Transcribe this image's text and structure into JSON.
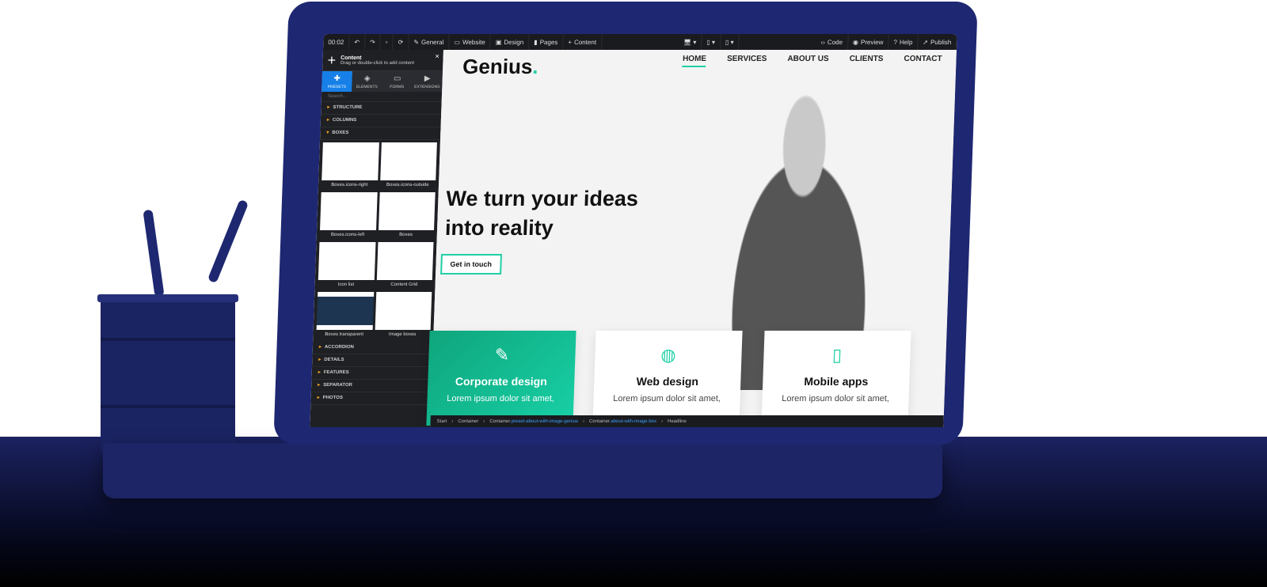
{
  "toolbar": {
    "time": "00:02",
    "general": "General",
    "website": "Website",
    "design": "Design",
    "pages": "Pages",
    "content": "Content",
    "code": "Code",
    "preview": "Preview",
    "help": "Help",
    "publish": "Publish"
  },
  "panel": {
    "title": "Content",
    "subtitle": "Drag or double-click to add content",
    "close": "×",
    "tabs": [
      {
        "label": "PRESETS",
        "icon": "puzzle-icon"
      },
      {
        "label": "ELEMENTS",
        "icon": "cube-icon"
      },
      {
        "label": "FORMS",
        "icon": "form-icon"
      },
      {
        "label": "EXTENSIONS",
        "icon": "play-icon"
      }
    ],
    "search_placeholder": "Search...",
    "categories_top": [
      "STRUCTURE",
      "COLUMNS",
      "BOXES"
    ],
    "presets": [
      "Boxes.icons-right",
      "Boxes.icons-outside",
      "Boxes.icons-left",
      "Boxes",
      "Icon list",
      "Content Grid",
      "Boxes transparent",
      "Image boxes"
    ],
    "categories_bottom": [
      "ACCORDION",
      "DETAILS",
      "FEATURES",
      "SEPARATOR",
      "PHOTOS"
    ]
  },
  "site": {
    "logo": "Genius",
    "logo_dot": ".",
    "nav": [
      "HOME",
      "SERVICES",
      "ABOUT US",
      "CLIENTS",
      "CONTACT"
    ],
    "hero_line1": "We turn your ideas",
    "hero_line2": "into reality",
    "cta": "Get in touch",
    "boxes": [
      {
        "title": "Corporate design",
        "text": "Lorem ipsum dolor sit amet,",
        "icon": "pencil-icon"
      },
      {
        "title": "Web design",
        "text": "Lorem ipsum dolor sit amet,",
        "icon": "globe-icon"
      },
      {
        "title": "Mobile apps",
        "text": "Lorem ipsum dolor sit amet,",
        "icon": "mobile-icon"
      }
    ],
    "accent": "#1fd0a5"
  },
  "breadcrumb": {
    "start": "Start",
    "c1": "Container",
    "c2": "Container",
    "c2_class": ".preset-about-with-image-genius",
    "c3": "Container",
    "c3_class": ".about-with-image-box",
    "last": "Headline"
  }
}
